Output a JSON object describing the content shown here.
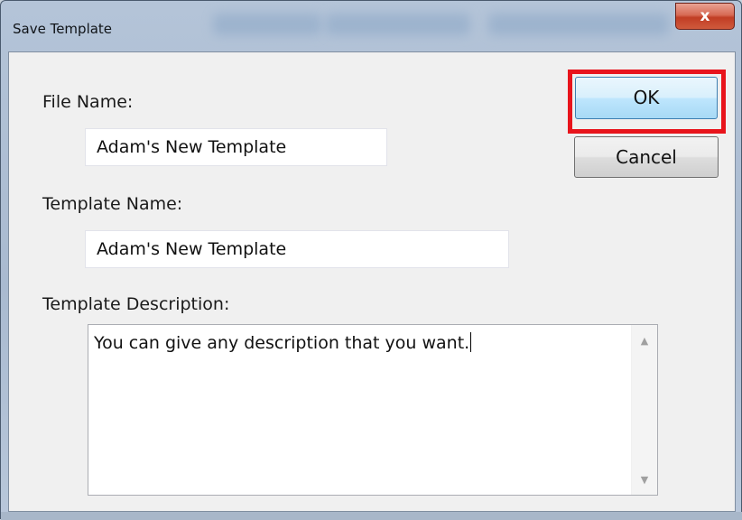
{
  "dialog": {
    "title": "Save Template",
    "close_label": "x"
  },
  "form": {
    "file_name_label": "File Name:",
    "file_name_value": "Adam's New Template",
    "template_name_label": "Template Name:",
    "template_name_value": "Adam's New Template",
    "template_description_label": "Template Description:",
    "template_description_value": "You can give any description that you want."
  },
  "buttons": {
    "ok_label": "OK",
    "cancel_label": "Cancel"
  },
  "colors": {
    "highlight": "#e8141c",
    "close_button": "#c13d24"
  },
  "icons": {
    "scroll_up": "scroll-up-arrow-icon",
    "scroll_down": "scroll-down-arrow-icon",
    "close": "close-icon"
  }
}
